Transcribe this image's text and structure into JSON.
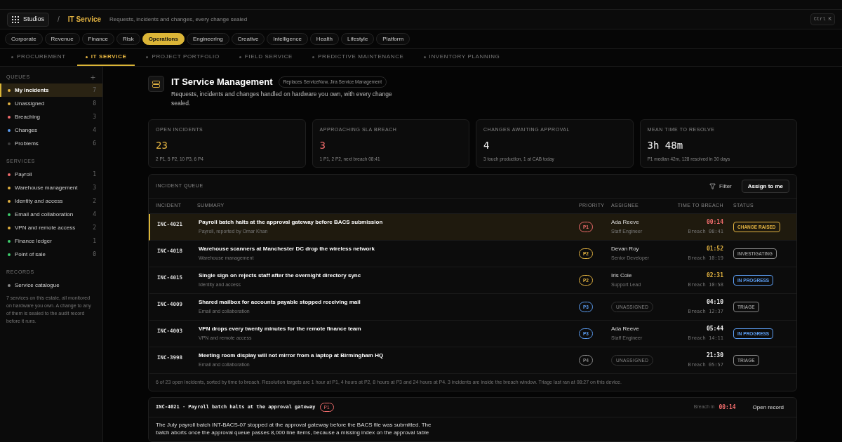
{
  "header": {
    "studios": "Studios",
    "separator": "/",
    "section": "IT Service",
    "tagline": "Requests, incidents and changes, every change sealed",
    "shortcut": "Ctrl K"
  },
  "categories": [
    {
      "label": "Corporate",
      "selected": false
    },
    {
      "label": "Revenue",
      "selected": false
    },
    {
      "label": "Finance",
      "selected": false
    },
    {
      "label": "Risk",
      "selected": false
    },
    {
      "label": "Operations",
      "selected": true
    },
    {
      "label": "Engineering",
      "selected": false
    },
    {
      "label": "Creative",
      "selected": false
    },
    {
      "label": "Intelligence",
      "selected": false
    },
    {
      "label": "Health",
      "selected": false
    },
    {
      "label": "Lifestyle",
      "selected": false
    },
    {
      "label": "Platform",
      "selected": false
    }
  ],
  "subnav": [
    {
      "label": "PROCUREMENT",
      "selected": false
    },
    {
      "label": "IT SERVICE",
      "selected": true
    },
    {
      "label": "PROJECT PORTFOLIO",
      "selected": false
    },
    {
      "label": "FIELD SERVICE",
      "selected": false
    },
    {
      "label": "PREDICTIVE MAINTENANCE",
      "selected": false
    },
    {
      "label": "INVENTORY PLANNING",
      "selected": false
    }
  ],
  "sidebar": {
    "sections": [
      {
        "title": "QUEUES",
        "addable": true,
        "items": [
          {
            "label": "My incidents",
            "count": "7",
            "color": "#e3b341",
            "selected": true
          },
          {
            "label": "Unassigned",
            "count": "8",
            "color": "#e3b341",
            "selected": false
          },
          {
            "label": "Breaching",
            "count": "3",
            "color": "#f26d6d",
            "selected": false
          },
          {
            "label": "Changes",
            "count": "4",
            "color": "#5b9cf0",
            "selected": false
          },
          {
            "label": "Problems",
            "count": "6",
            "color": "#3a3a3a",
            "selected": false
          }
        ]
      },
      {
        "title": "SERVICES",
        "addable": false,
        "items": [
          {
            "label": "Payroll",
            "count": "1",
            "color": "#f26d6d",
            "selected": false
          },
          {
            "label": "Warehouse management",
            "count": "3",
            "color": "#e3b341",
            "selected": false
          },
          {
            "label": "Identity and access",
            "count": "2",
            "color": "#e3b341",
            "selected": false
          },
          {
            "label": "Email and collaboration",
            "count": "4",
            "color": "#3ecf6e",
            "selected": false
          },
          {
            "label": "VPN and remote access",
            "count": "2",
            "color": "#e3b341",
            "selected": false
          },
          {
            "label": "Finance ledger",
            "count": "1",
            "color": "#3ecf6e",
            "selected": false
          },
          {
            "label": "Point of sale",
            "count": "0",
            "color": "#3ecf6e",
            "selected": false
          }
        ]
      },
      {
        "title": "RECORDS",
        "addable": false,
        "items": [
          {
            "label": "Service catalogue",
            "color": "#8a8a8a",
            "selected": false
          }
        ]
      }
    ],
    "note": "7 services on this estate, all monitored on hardware you own. A change to any of them is sealed to the audit record before it runs."
  },
  "page": {
    "title": "IT Service Management",
    "badge": "Replaces ServiceNow, Jira Service Management",
    "description": "Requests, incidents and changes handled on hardware you own, with every change sealed."
  },
  "stats": [
    {
      "label": "OPEN INCIDENTS",
      "value": "23",
      "color": "#e3b341",
      "note": "2 P1, 5 P2, 10 P3, 6 P4"
    },
    {
      "label": "APPROACHING SLA BREACH",
      "value": "3",
      "color": "#f26d6d",
      "note": "1 P1, 2 P2, next breach 08:41"
    },
    {
      "label": "CHANGES AWAITING APPROVAL",
      "value": "4",
      "color": "#f2f2f2",
      "note": "3 touch production, 1 at CAB today"
    },
    {
      "label": "MEAN TIME TO RESOLVE",
      "value": "3h 48m",
      "color": "#f2f2f2",
      "note": "P1 median 42m, 128 resolved in 30 days"
    }
  ],
  "queue": {
    "title": "INCIDENT QUEUE",
    "filter": "Filter",
    "assign": "Assign to me",
    "columns": [
      "INCIDENT",
      "SUMMARY",
      "PRIORITY",
      "ASSIGNEE",
      "TIME TO BREACH",
      "STATUS"
    ],
    "rows": [
      {
        "id": "INC-4021",
        "summary": "Payroll batch halts at the approval gateway before BACS submission",
        "sub": "Payroll, reported by Omar Khan",
        "priority": {
          "label": "P1",
          "color": "#f26d6d"
        },
        "assignee": {
          "kind": "person",
          "name": "Ada Reeve",
          "role": "Staff Engineer"
        },
        "time": {
          "label": "00:14",
          "color": "#f26d6d"
        },
        "breach": "Breach 08:41",
        "status": {
          "label": "CHANGE RAISED",
          "color": "#e3b341"
        },
        "selected": true
      },
      {
        "id": "INC-4018",
        "summary": "Warehouse scanners at Manchester DC drop the wireless network",
        "sub": "Warehouse management",
        "priority": {
          "label": "P2",
          "color": "#e3b341"
        },
        "assignee": {
          "kind": "person",
          "name": "Devan Roy",
          "role": "Senior Developer"
        },
        "time": {
          "label": "01:52",
          "color": "#e3b341"
        },
        "breach": "Breach 10:19",
        "status": {
          "label": "INVESTIGATING",
          "color": "#8a8a8a"
        },
        "selected": false
      },
      {
        "id": "INC-4015",
        "summary": "Single sign on rejects staff after the overnight directory sync",
        "sub": "Identity and access",
        "priority": {
          "label": "P2",
          "color": "#e3b341"
        },
        "assignee": {
          "kind": "person",
          "name": "Iris Cole",
          "role": "Support Lead"
        },
        "time": {
          "label": "02:31",
          "color": "#e3b341"
        },
        "breach": "Breach 10:58",
        "status": {
          "label": "IN PROGRESS",
          "color": "#5b9cf0"
        },
        "selected": false
      },
      {
        "id": "INC-4009",
        "summary": "Shared mailbox for accounts payable stopped receiving mail",
        "sub": "Email and collaboration",
        "priority": {
          "label": "P3",
          "color": "#5b9cf0"
        },
        "assignee": {
          "kind": "unassigned",
          "label": "UNASSIGNED"
        },
        "time": {
          "label": "04:10",
          "color": "#f2f2f2"
        },
        "breach": "Breach 12:37",
        "status": {
          "label": "TRIAGE",
          "color": "#8a8a8a"
        },
        "selected": false
      },
      {
        "id": "INC-4003",
        "summary": "VPN drops every twenty minutes for the remote finance team",
        "sub": "VPN and remote access",
        "priority": {
          "label": "P3",
          "color": "#5b9cf0"
        },
        "assignee": {
          "kind": "person",
          "name": "Ada Reeve",
          "role": "Staff Engineer"
        },
        "time": {
          "label": "05:44",
          "color": "#f2f2f2"
        },
        "breach": "Breach 14:11",
        "status": {
          "label": "IN PROGRESS",
          "color": "#5b9cf0"
        },
        "selected": false
      },
      {
        "id": "INC-3998",
        "summary": "Meeting room display will not mirror from a laptop at Birmingham HQ",
        "sub": "Email and collaboration",
        "priority": {
          "label": "P4",
          "color": "#8a8a8a"
        },
        "assignee": {
          "kind": "unassigned",
          "label": "UNASSIGNED"
        },
        "time": {
          "label": "21:30",
          "color": "#f2f2f2"
        },
        "breach": "Breach 05:57",
        "status": {
          "label": "TRIAGE",
          "color": "#8a8a8a"
        },
        "selected": false
      }
    ],
    "footer": "6 of 23 open incidents, sorted by time to breach. Resolution targets are 1 hour at P1, 4 hours at P2, 8 hours at P3 and 24 hours at P4. 3 incidents are inside the breach window. Triage last ran at 08:27 on this device."
  },
  "detail": {
    "title": "INC-4021 · Payroll batch halts at the approval gateway",
    "priority": {
      "label": "P1",
      "color": "#f26d6d"
    },
    "breach_label": "Breach in",
    "breach_time": "00:14",
    "open": "Open record",
    "body": "The July payroll batch INT-BACS-07 stopped at the approval gateway before the BACS file was submitted. The batch aborts once the approval queue passes 8,000 line items, because a missing index on the approval table"
  }
}
